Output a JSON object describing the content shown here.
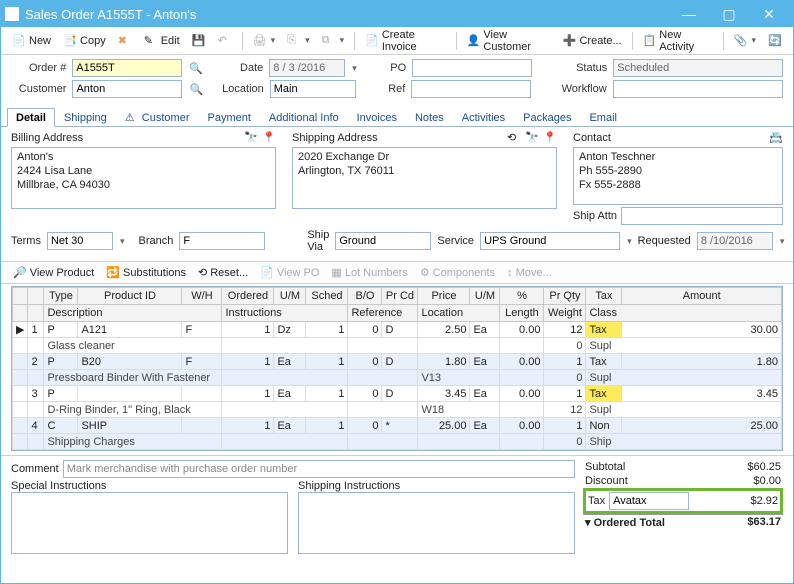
{
  "window": {
    "title": "Sales Order A1555T - Anton's"
  },
  "toolbar": {
    "new_label": "New",
    "copy_label": "Copy",
    "edit_label": "Edit",
    "create_invoice": "Create Invoice",
    "view_customer": "View Customer",
    "create": "Create...",
    "new_activity": "New Activity"
  },
  "form": {
    "order_lbl": "Order #",
    "order_val": "A1555T",
    "date_lbl": "Date",
    "date_val": "8 / 3 /2016",
    "po_lbl": "PO",
    "po_val": "",
    "status_lbl": "Status",
    "status_val": "Scheduled",
    "customer_lbl": "Customer",
    "customer_val": "Anton",
    "location_lbl": "Location",
    "location_val": "Main",
    "ref_lbl": "Ref",
    "ref_val": "",
    "workflow_lbl": "Workflow",
    "workflow_val": ""
  },
  "tabs": {
    "detail": "Detail",
    "shipping": "Shipping",
    "customer": "Customer",
    "payment": "Payment",
    "additional": "Additional Info",
    "invoices": "Invoices",
    "notes": "Notes",
    "activities": "Activities",
    "packages": "Packages",
    "email": "Email"
  },
  "addr": {
    "billing_lbl": "Billing Address",
    "billing_lines": "Anton's\n2424 Lisa Lane\nMillbrae, CA 94030",
    "shipping_lbl": "Shipping Address",
    "shipping_lines": "2020 Exchange Dr\nArlington, TX 76011",
    "contact_lbl": "Contact",
    "contact_lines": "Anton Teschner\nPh 555-2890\nFx 555-2888",
    "ship_attn_lbl": "Ship Attn",
    "ship_attn_val": ""
  },
  "row2": {
    "terms_lbl": "Terms",
    "terms_val": "Net 30",
    "branch_lbl": "Branch",
    "branch_val": "F",
    "shipvia_lbl": "Ship Via",
    "shipvia_val": "Ground",
    "service_lbl": "Service",
    "service_val": "UPS Ground",
    "requested_lbl": "Requested",
    "requested_val": "8 /10/2016"
  },
  "gridbar": {
    "view_product": "View Product",
    "substitutions": "Substitutions",
    "reset": "Reset...",
    "view_po": "View PO",
    "lot_numbers": "Lot Numbers",
    "components": "Components",
    "move": "Move..."
  },
  "cols": {
    "blank": "",
    "type": "Type",
    "product": "Product ID",
    "wh": "W/H",
    "ordered": "Ordered",
    "um": "U/M",
    "sched": "Sched",
    "bo": "B/O",
    "prcd": "Pr Cd",
    "price": "Price",
    "um2": "U/M",
    "pct": "%",
    "prqty": "Pr Qty",
    "tax": "Tax",
    "amount": "Amount",
    "desc": "Description",
    "instr": "Instructions",
    "ref": "Reference",
    "loc": "Location",
    "length": "Length",
    "weight": "Weight",
    "class": "Class"
  },
  "rows": [
    {
      "n": "1",
      "type": "P",
      "pid": "A121",
      "wh": "F",
      "ord": "1",
      "um": "Dz",
      "sch": "1",
      "bo": "0",
      "prcd": "D",
      "price": "2.50",
      "um2": "Ea",
      "pct": "0.00",
      "prqty": "12",
      "tax": "Tax",
      "amt": "30.00",
      "desc": "Glass cleaner",
      "instr": "",
      "ref": "",
      "loc": "",
      "len": "",
      "wt": "0",
      "cls": "Supl",
      "blue": false,
      "taxhl": true
    },
    {
      "n": "2",
      "type": "P",
      "pid": "B20",
      "wh": "F",
      "ord": "1",
      "um": "Ea",
      "sch": "1",
      "bo": "0",
      "prcd": "D",
      "price": "1.80",
      "um2": "Ea",
      "pct": "0.00",
      "prqty": "1",
      "tax": "Tax",
      "amt": "1.80",
      "desc": "Pressboard Binder With Fastener",
      "instr": "",
      "ref": "",
      "loc": "V13",
      "len": "",
      "wt": "0",
      "cls": "Supl",
      "blue": true,
      "taxhl": true
    },
    {
      "n": "3",
      "type": "P",
      "pid": "",
      "wh": "",
      "ord": "1",
      "um": "Ea",
      "sch": "1",
      "bo": "0",
      "prcd": "D",
      "price": "3.45",
      "um2": "Ea",
      "pct": "0.00",
      "prqty": "1",
      "tax": "Tax",
      "amt": "3.45",
      "desc": "D-Ring Binder, 1\" Ring, Black",
      "instr": "",
      "ref": "",
      "loc": "W18",
      "len": "",
      "wt": "12",
      "cls": "Supl",
      "blue": false,
      "taxhl": true
    },
    {
      "n": "4",
      "type": "C",
      "pid": "SHIP",
      "wh": "",
      "ord": "1",
      "um": "Ea",
      "sch": "1",
      "bo": "0",
      "prcd": "*",
      "price": "25.00",
      "um2": "Ea",
      "pct": "0.00",
      "prqty": "1",
      "tax": "Non",
      "amt": "25.00",
      "desc": "Shipping Charges",
      "instr": "",
      "ref": "",
      "loc": "",
      "len": "",
      "wt": "0",
      "cls": "Ship",
      "blue": true,
      "taxhl": true
    }
  ],
  "comment": {
    "lbl": "Comment",
    "placeholder": "Mark merchandise with purchase order number",
    "special_lbl": "Special Instructions",
    "ship_instr_lbl": "Shipping Instructions"
  },
  "totals": {
    "subtotal_lbl": "Subtotal",
    "subtotal": "$60.25",
    "discount_lbl": "Discount",
    "discount": "$0.00",
    "tax_lbl": "Tax",
    "tax_engine": "Avatax",
    "tax": "$2.92",
    "ordered_lbl": "Ordered Total",
    "ordered": "$63.17"
  }
}
